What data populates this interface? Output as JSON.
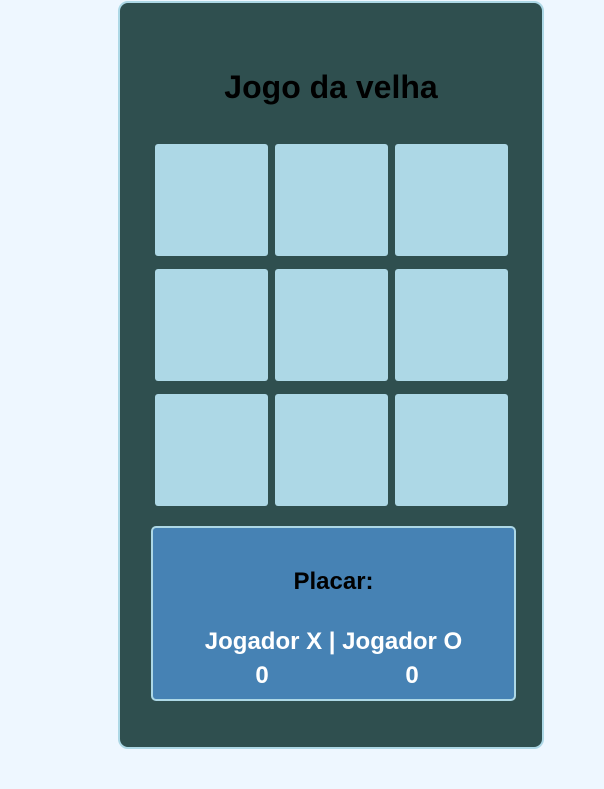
{
  "title": "Jogo da velha",
  "board": {
    "cells": [
      "",
      "",
      "",
      "",
      "",
      "",
      "",
      "",
      ""
    ]
  },
  "scoreboard": {
    "title": "Placar:",
    "players_label": "Jogador X | Jogador O",
    "score_x": "0",
    "score_o": "0"
  },
  "colors": {
    "page_background": "#eef7ff",
    "panel_background": "#2f4f4f",
    "panel_border": "#add8e6",
    "cell_background": "#add8e6",
    "scoreboard_background": "#4682b4"
  }
}
